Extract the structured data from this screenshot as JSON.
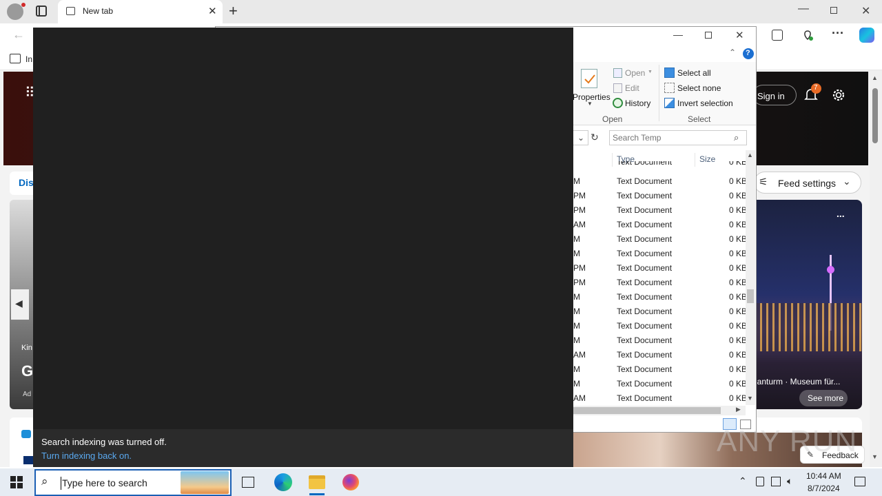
{
  "browser": {
    "tab_title": "New tab",
    "favorites_prefix": "In",
    "signin_label": "Sign in",
    "notification_count": "7",
    "feed_settings_label": "Feed settings",
    "tab_discover": "Dis",
    "card_more": "...",
    "card_caption": "ianturm · Museum für...",
    "see_more": "See more",
    "feedback_label": "Feedback",
    "left_card_kicker": "Kin",
    "left_card_headline": "G",
    "left_card_ad": "Ad"
  },
  "explorer": {
    "ribbon": {
      "properties_label": "Properties",
      "open_label": "Open",
      "edit_label": "Edit",
      "history_label": "History",
      "open_group": "Open",
      "select_all": "Select all",
      "select_none": "Select none",
      "invert_selection": "Invert selection",
      "select_group": "Select"
    },
    "search_placeholder": "Search Temp",
    "columns": {
      "type": "Type",
      "size": "Size"
    },
    "top_partial_row": "Text Document",
    "top_partial_size": "0 KB",
    "rows": [
      {
        "time": "M",
        "type": "Text Document",
        "size": "0 KB"
      },
      {
        "time": "PM",
        "type": "Text Document",
        "size": "0 KB"
      },
      {
        "time": "PM",
        "type": "Text Document",
        "size": "0 KB"
      },
      {
        "time": "AM",
        "type": "Text Document",
        "size": "0 KB"
      },
      {
        "time": "M",
        "type": "Text Document",
        "size": "0 KB"
      },
      {
        "time": "M",
        "type": "Text Document",
        "size": "0 KB"
      },
      {
        "time": "PM",
        "type": "Text Document",
        "size": "0 KB"
      },
      {
        "time": "PM",
        "type": "Text Document",
        "size": "0 KB"
      },
      {
        "time": "M",
        "type": "Text Document",
        "size": "0 KB"
      },
      {
        "time": "M",
        "type": "Text Document",
        "size": "0 KB"
      },
      {
        "time": "M",
        "type": "Text Document",
        "size": "0 KB"
      },
      {
        "time": "M",
        "type": "Text Document",
        "size": "0 KB"
      },
      {
        "time": "AM",
        "type": "Text Document",
        "size": "0 KB"
      },
      {
        "time": "M",
        "type": "Text Document",
        "size": "0 KB"
      },
      {
        "time": "M",
        "type": "Text Document",
        "size": "0 KB"
      },
      {
        "time": "AM",
        "type": "Text Document",
        "size": "0 KB"
      }
    ]
  },
  "search_panel": {
    "message": "Search indexing was turned off.",
    "link": "Turn indexing back on."
  },
  "taskbar": {
    "search_placeholder": "Type here to search",
    "time": "10:44 AM",
    "date": "8/7/2024"
  },
  "watermark": "ANY RUN",
  "colors": {
    "accent": "#0067c0",
    "link": "#5aa9f0",
    "panel": "#202020"
  }
}
